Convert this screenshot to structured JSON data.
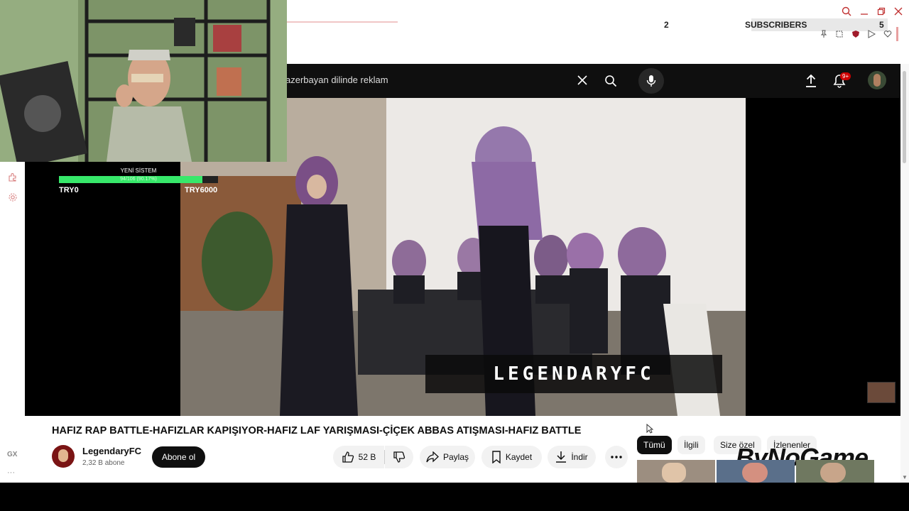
{
  "browser": {
    "subscriber_widget": {
      "left_value": "2",
      "label": "SUBSCRIBERS",
      "right_value": "5",
      "progress": 0.4
    },
    "window_controls": [
      "search-icon",
      "minimize-icon",
      "restore-icon",
      "close-icon"
    ],
    "extension_icons": [
      "pin-icon",
      "snapshot-icon",
      "shield-icon",
      "play-icon",
      "heart-icon"
    ]
  },
  "sidebar": {
    "items": [
      "extensions-icon",
      "settings-icon"
    ],
    "gx_label": "GX",
    "more_label": "···"
  },
  "youtube": {
    "search": {
      "query": "azerbayan dilinde reklam"
    },
    "notifications_badge": "9+"
  },
  "overlay": {
    "goal_label": "YENİ SİSTEM",
    "goal_progress_text": "94/106 (90.17%)",
    "goal_fraction": 0.9017,
    "left_amount": "TRY0",
    "right_amount": "TRY6000",
    "watermark": "LEGENDARYFC"
  },
  "video": {
    "title": "HAFIZ RAP BATTLE-HAFIZLAR KAPIŞIYOR-HAFIZ LAF YARIŞMASI-ÇİÇEK ABBAS ATIŞMASI-HAFIZ BATTLE",
    "channel": "LegendaryFC",
    "subscribers": "2,32 B abone",
    "subscribe_label": "Abone ol",
    "likes": "52 B",
    "share_label": "Paylaş",
    "save_label": "Kaydet",
    "download_label": "İndir"
  },
  "recommendations": {
    "chips": [
      {
        "label": "Tümü",
        "active": true
      },
      {
        "label": "İlgili",
        "active": false
      },
      {
        "label": "Size özel",
        "active": false
      },
      {
        "label": "İzlenenler",
        "active": false
      }
    ]
  },
  "brand_overlay": "ByNoGame",
  "colors": {
    "yt_dark": "#0f0f0f",
    "goal_green": "#37e86a",
    "badge_red": "#cc0000",
    "opera_red": "#d98080"
  }
}
